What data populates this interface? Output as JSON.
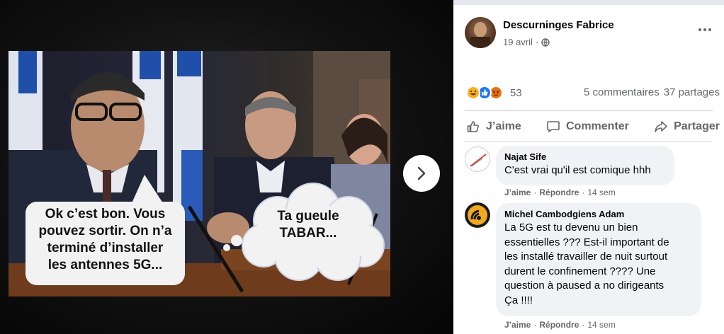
{
  "post": {
    "author": "Descurninges Fabrice",
    "date": "19 avril",
    "privacy_icon": "globe-icon",
    "reactions": {
      "icons": [
        "haha",
        "like",
        "angry"
      ],
      "count": "53"
    },
    "comments_count": "5 commentaires",
    "shares_count": "37 partages"
  },
  "image": {
    "bubble_left": "Ok c’est bon. Vous\npouvez sortir. On n’a\nterminé d’installer\nles antennes 5G...",
    "bubble_right": "Ta gueule\nTABAR..."
  },
  "actions": {
    "like": "J’aime",
    "comment": "Commenter",
    "share": "Partager"
  },
  "comments": [
    {
      "name": "Najat Sife",
      "text": "C'est vrai qu'il est comique hhh",
      "like": "J’aime",
      "reply": "Répondre",
      "time": "14 sem"
    },
    {
      "name": "Michel Cambodgiens Adam",
      "text": "La 5G est tu devenu un bien\nessentielles ??? Est-il important de\nles installé travailler de nuit surtout\ndurent le confinement ???? Une\nquestion à paused a no dirigeants\nÇa !!!!",
      "like": "J’aime",
      "reply": "Répondre",
      "time": "14 sem"
    }
  ],
  "colors": {
    "accent": "#1877f2",
    "muted": "#65676b",
    "bubble": "#f0f2f5"
  }
}
